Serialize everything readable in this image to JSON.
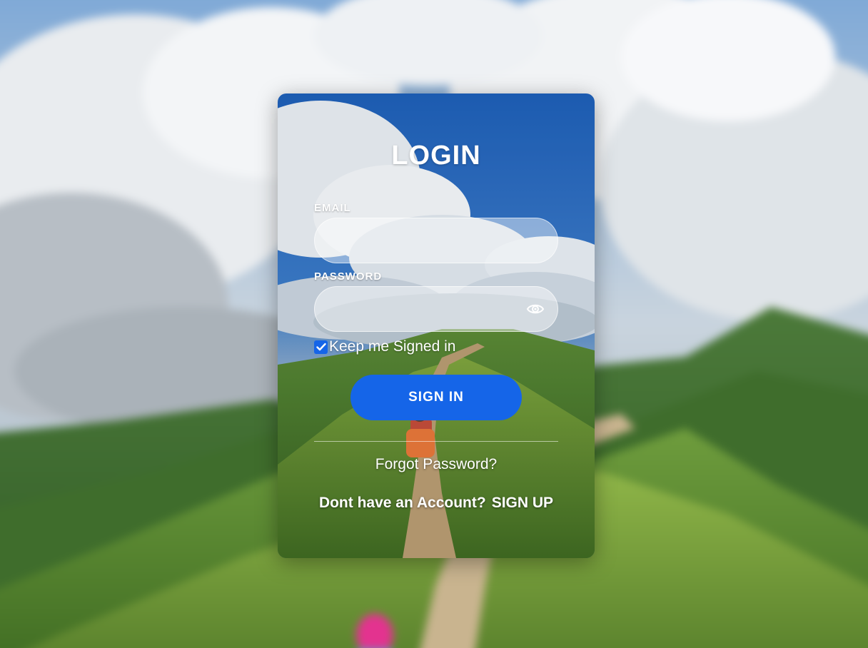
{
  "login": {
    "title": "LOGIN",
    "email": {
      "label": "EMAIL",
      "value": "",
      "placeholder": ""
    },
    "password": {
      "label": "PASSWORD",
      "value": "",
      "placeholder": "",
      "toggle_icon": "eye-icon"
    },
    "keep_signed_in": {
      "label": "Keep me Signed in",
      "checked": true
    },
    "sign_in_button": "SIGN IN",
    "forgot_password": "Forgot Password?",
    "no_account_text": "Dont have an Account?",
    "sign_up_link": "SIGN UP"
  },
  "colors": {
    "accent": "#1565e8",
    "text": "#ffffff"
  }
}
